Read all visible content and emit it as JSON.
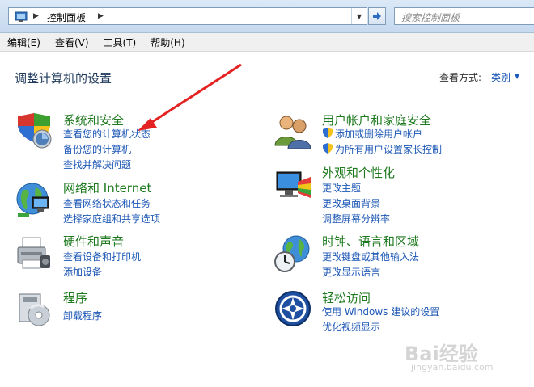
{
  "address": {
    "path_label": "控制面板"
  },
  "search": {
    "placeholder": "搜索控制面板"
  },
  "menu": [
    "编辑(E)",
    "查看(V)",
    "工具(T)",
    "帮助(H)"
  ],
  "header": {
    "title": "调整计算机的设置",
    "viewby_label": "查看方式:",
    "viewby_value": "类别"
  },
  "categories": [
    {
      "icon": "shield-icon",
      "title": "系统和安全",
      "links": [
        "查看您的计算机状态",
        "备份您的计算机",
        "查找并解决问题"
      ]
    },
    {
      "icon": "network-icon",
      "title": "网络和 Internet",
      "links": [
        "查看网络状态和任务",
        "选择家庭组和共享选项"
      ]
    },
    {
      "icon": "printer-icon",
      "title": "硬件和声音",
      "links": [
        "查看设备和打印机",
        "添加设备"
      ]
    },
    {
      "icon": "programs-icon",
      "title": "程序",
      "links": [
        "卸载程序"
      ]
    },
    {
      "icon": "users-icon",
      "title": "用户帐户和家庭安全",
      "links": [
        "添加或删除用户帐户",
        "为所有用户设置家长控制"
      ]
    },
    {
      "icon": "appearance-icon",
      "title": "外观和个性化",
      "links": [
        "更改主题",
        "更改桌面背景",
        "调整屏幕分辨率"
      ]
    },
    {
      "icon": "clock-globe-icon",
      "title": "时钟、语言和区域",
      "links": [
        "更改键盘或其他输入法",
        "更改显示语言"
      ]
    },
    {
      "icon": "accessibility-icon",
      "title": "轻松访问",
      "links": [
        "使用 Windows 建议的设置",
        "优化视频显示"
      ]
    }
  ],
  "watermark": {
    "brand": "Bai经验",
    "url": "jingyan.baidu.com"
  }
}
